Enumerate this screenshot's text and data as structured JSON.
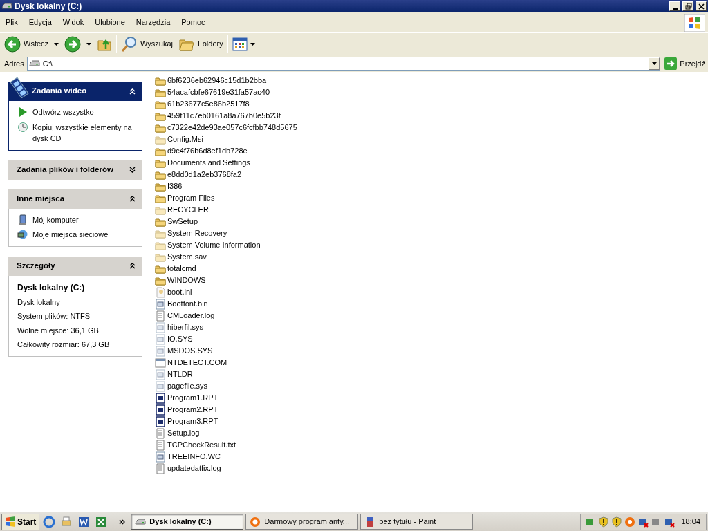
{
  "window": {
    "title": "Dysk lokalny (C:)"
  },
  "menu": [
    "Plik",
    "Edycja",
    "Widok",
    "Ulubione",
    "Narzędzia",
    "Pomoc"
  ],
  "toolbar": {
    "back": "Wstecz",
    "search": "Wyszukaj",
    "folders": "Foldery"
  },
  "address": {
    "label": "Adres",
    "value": "C:\\",
    "go": "Przejdź"
  },
  "panels": [
    {
      "title": "Zadania wideo",
      "kind": "special",
      "expanded": true,
      "items": [
        {
          "label": "Odtwórz wszystko"
        },
        {
          "label": "Kopiuj wszystkie elementy na dysk CD"
        }
      ]
    },
    {
      "title": "Zadania plików i folderów",
      "kind": "normal",
      "expanded": false
    },
    {
      "title": "Inne miejsca",
      "kind": "normal",
      "expanded": true,
      "items": [
        {
          "label": "Mój komputer"
        },
        {
          "label": "Moje miejsca sieciowe"
        }
      ]
    },
    {
      "title": "Szczegóły",
      "kind": "details",
      "expanded": true,
      "name": "Dysk lokalny (C:)",
      "lines": [
        "Dysk lokalny",
        "System plików: NTFS",
        "Wolne miejsce: 36,1 GB",
        "Całkowity rozmiar: 67,3 GB"
      ]
    }
  ],
  "files": [
    {
      "name": "6bf6236eb62946c15d1b2bba",
      "kind": "folder",
      "hidden": false
    },
    {
      "name": "54acafcbfe67619e31fa57ac40",
      "kind": "folder",
      "hidden": false
    },
    {
      "name": "61b23677c5e86b2517f8",
      "kind": "folder",
      "hidden": false
    },
    {
      "name": "459f11c7eb0161a8a767b0e5b23f",
      "kind": "folder",
      "hidden": false
    },
    {
      "name": "c7322e42de93ae057c6fcfbb748d5675",
      "kind": "folder",
      "hidden": false
    },
    {
      "name": "Config.Msi",
      "kind": "folder",
      "hidden": true
    },
    {
      "name": "d9c4f76b6d8ef1db728e",
      "kind": "folder",
      "hidden": false
    },
    {
      "name": "Documents and Settings",
      "kind": "folder",
      "hidden": false
    },
    {
      "name": "e8dd0d1a2eb3768fa2",
      "kind": "folder",
      "hidden": false
    },
    {
      "name": "I386",
      "kind": "folder",
      "hidden": false
    },
    {
      "name": "Program Files",
      "kind": "folder",
      "hidden": false
    },
    {
      "name": "RECYCLER",
      "kind": "folder",
      "hidden": true
    },
    {
      "name": "SwSetup",
      "kind": "folder",
      "hidden": false
    },
    {
      "name": "System Recovery",
      "kind": "folder",
      "hidden": true
    },
    {
      "name": "System Volume Information",
      "kind": "folder",
      "hidden": true
    },
    {
      "name": "System.sav",
      "kind": "folder",
      "hidden": true
    },
    {
      "name": "totalcmd",
      "kind": "folder",
      "hidden": false
    },
    {
      "name": "WINDOWS",
      "kind": "folder",
      "hidden": false
    },
    {
      "name": "boot.ini",
      "kind": "settings",
      "hidden": true
    },
    {
      "name": "Bootfont.bin",
      "kind": "system",
      "hidden": false
    },
    {
      "name": "CMLoader.log",
      "kind": "text",
      "hidden": false
    },
    {
      "name": "hiberfil.sys",
      "kind": "system",
      "hidden": true
    },
    {
      "name": "IO.SYS",
      "kind": "system",
      "hidden": true
    },
    {
      "name": "MSDOS.SYS",
      "kind": "system",
      "hidden": true
    },
    {
      "name": "NTDETECT.COM",
      "kind": "app",
      "hidden": false
    },
    {
      "name": "NTLDR",
      "kind": "system",
      "hidden": true
    },
    {
      "name": "pagefile.sys",
      "kind": "system",
      "hidden": true
    },
    {
      "name": "Program1.RPT",
      "kind": "report",
      "hidden": false
    },
    {
      "name": "Program2.RPT",
      "kind": "report",
      "hidden": false
    },
    {
      "name": "Program3.RPT",
      "kind": "report",
      "hidden": false
    },
    {
      "name": "Setup.log",
      "kind": "text",
      "hidden": false
    },
    {
      "name": "TCPCheckResult.txt",
      "kind": "text",
      "hidden": false
    },
    {
      "name": "TREEINFO.WC",
      "kind": "system",
      "hidden": false
    },
    {
      "name": "updatedatfix.log",
      "kind": "text",
      "hidden": false
    }
  ],
  "taskbar": {
    "start": "Start",
    "tasks": [
      {
        "label": "Dysk lokalny (C:)",
        "selected": true
      },
      {
        "label": "Darmowy program anty...",
        "selected": false
      },
      {
        "label": "bez tytułu - Paint",
        "selected": false
      }
    ],
    "clock": "18:04"
  }
}
